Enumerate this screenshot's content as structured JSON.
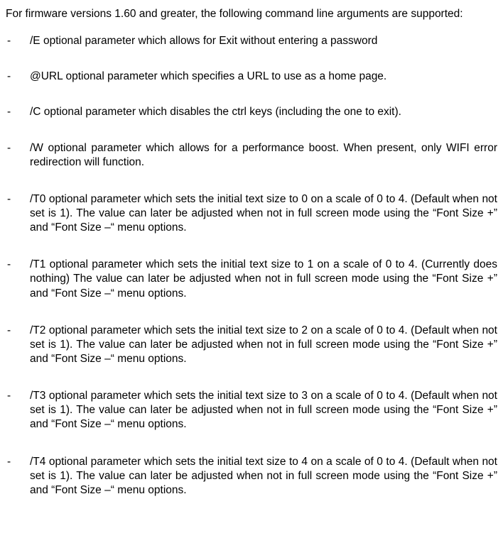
{
  "intro": "For firmware versions 1.60 and greater, the following command line arguments are supported:",
  "items": [
    {
      "bullet": "-",
      "text": "/E optional parameter which allows for Exit without entering a password"
    },
    {
      "bullet": "-",
      "text": "@URL optional parameter which specifies a URL to use as a home page."
    },
    {
      "bullet": "-",
      "text": "/C optional parameter which disables the ctrl keys (including the one to exit)."
    },
    {
      "bullet": "-",
      "text": "/W optional parameter which allows for a performance boost. When present, only WIFI error redirection will function."
    },
    {
      "bullet": "-",
      "text": "/T0 optional parameter which sets the initial text size to 0 on a scale of 0 to 4. (Default when not set is 1). The value can later be adjusted when not in full screen mode using the “Font Size +” and “Font Size –“ menu options."
    },
    {
      "bullet": "-",
      "text": "/T1 optional parameter which sets the initial text size to 1 on a scale of 0 to 4. (Currently does nothing) The value can later be adjusted when not in full screen mode using the “Font Size +” and “Font Size –“ menu options."
    },
    {
      "bullet": "-",
      "text": "/T2 optional parameter which sets the initial text size to 2 on a scale of 0 to 4. (Default when not set is 1). The value can later be adjusted when not in full screen mode using the “Font Size +” and “Font Size –“ menu options."
    },
    {
      "bullet": "-",
      "text": "/T3 optional parameter which sets the initial text size to 3 on a scale of 0 to 4. (Default when not set is 1). The value can later be adjusted when not in full screen mode using the “Font Size +” and “Font Size –“ menu options."
    },
    {
      "bullet": "-",
      "text": "/T4 optional parameter which sets the initial text size to 4 on a scale of 0 to 4. (Default when not set is 1). The value can later be adjusted when not in full screen mode using the “Font Size +” and “Font Size –“ menu options."
    }
  ]
}
